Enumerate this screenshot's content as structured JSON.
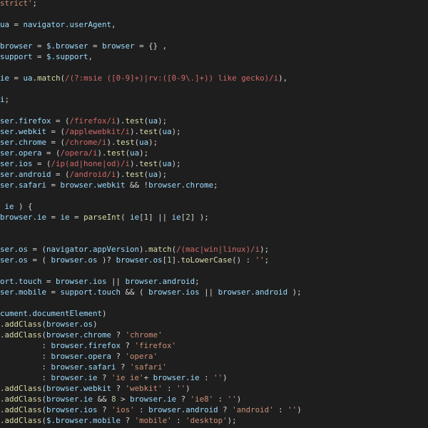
{
  "editor": {
    "theme": {
      "background": "#1e1e1e",
      "identifier": "#9cdcfe",
      "punctuation": "#d4d4d4",
      "string": "#ce9178",
      "regex": "#d16969",
      "function": "#dcdcaa",
      "number": "#b5cea8"
    },
    "lines": [
      [
        [
          "str",
          "strict'"
        ],
        [
          "punc",
          ";"
        ]
      ],
      [],
      [
        [
          "text",
          "ua"
        ],
        [
          "punc",
          " = "
        ],
        [
          "text",
          "navigator.userAgent"
        ],
        [
          "punc",
          ","
        ]
      ],
      [],
      [
        [
          "text",
          "browser"
        ],
        [
          "punc",
          " = "
        ],
        [
          "text",
          "$.browser"
        ],
        [
          "punc",
          " = "
        ],
        [
          "text",
          "browser"
        ],
        [
          "punc",
          " = {} ,"
        ]
      ],
      [
        [
          "text",
          "support"
        ],
        [
          "punc",
          " = "
        ],
        [
          "text",
          "$.support"
        ],
        [
          "punc",
          ","
        ]
      ],
      [],
      [
        [
          "text",
          "ie"
        ],
        [
          "punc",
          " = "
        ],
        [
          "text",
          "ua"
        ],
        [
          "punc",
          "."
        ],
        [
          "func",
          "match"
        ],
        [
          "punc",
          "("
        ],
        [
          "regex",
          "/(?:msie ([0-9]+)|rv:([0-9\\.]+)) like gecko)/i"
        ],
        [
          "punc",
          "),"
        ]
      ],
      [],
      [
        [
          "text",
          "i"
        ],
        [
          "punc",
          ";"
        ]
      ],
      [],
      [
        [
          "text",
          "ser.firefox"
        ],
        [
          "punc",
          " = ("
        ],
        [
          "regex",
          "/firefox/i"
        ],
        [
          "punc",
          ")."
        ],
        [
          "func",
          "test"
        ],
        [
          "punc",
          "("
        ],
        [
          "text",
          "ua"
        ],
        [
          "punc",
          ");"
        ]
      ],
      [
        [
          "text",
          "ser.webkit"
        ],
        [
          "punc",
          " = ("
        ],
        [
          "regex",
          "/applewebkit/i"
        ],
        [
          "punc",
          ")."
        ],
        [
          "func",
          "test"
        ],
        [
          "punc",
          "("
        ],
        [
          "text",
          "ua"
        ],
        [
          "punc",
          ");"
        ]
      ],
      [
        [
          "text",
          "ser.chrome"
        ],
        [
          "punc",
          " = ("
        ],
        [
          "regex",
          "/chrome/i"
        ],
        [
          "punc",
          ")."
        ],
        [
          "func",
          "test"
        ],
        [
          "punc",
          "("
        ],
        [
          "text",
          "ua"
        ],
        [
          "punc",
          ");"
        ]
      ],
      [
        [
          "text",
          "ser.opera"
        ],
        [
          "punc",
          " = ("
        ],
        [
          "regex",
          "/opera/i"
        ],
        [
          "punc",
          ")."
        ],
        [
          "func",
          "test"
        ],
        [
          "punc",
          "("
        ],
        [
          "text",
          "ua"
        ],
        [
          "punc",
          ");"
        ]
      ],
      [
        [
          "text",
          "ser.ios"
        ],
        [
          "punc",
          " = ("
        ],
        [
          "regex",
          "/ip(ad|hone|od)/i"
        ],
        [
          "punc",
          ")."
        ],
        [
          "func",
          "test"
        ],
        [
          "punc",
          "("
        ],
        [
          "text",
          "ua"
        ],
        [
          "punc",
          ");"
        ]
      ],
      [
        [
          "text",
          "ser.android"
        ],
        [
          "punc",
          " = ("
        ],
        [
          "regex",
          "/android/i"
        ],
        [
          "punc",
          ")."
        ],
        [
          "func",
          "test"
        ],
        [
          "punc",
          "("
        ],
        [
          "text",
          "ua"
        ],
        [
          "punc",
          ");"
        ]
      ],
      [
        [
          "text",
          "ser.safari"
        ],
        [
          "punc",
          " = "
        ],
        [
          "text",
          "browser.webkit"
        ],
        [
          "punc",
          " && !"
        ],
        [
          "text",
          "browser.chrome"
        ],
        [
          "punc",
          ";"
        ]
      ],
      [],
      [
        [
          "punc",
          " "
        ],
        [
          "text",
          "ie"
        ],
        [
          "punc",
          " ) {"
        ]
      ],
      [
        [
          "text",
          "browser.ie"
        ],
        [
          "punc",
          " = "
        ],
        [
          "text",
          "ie"
        ],
        [
          "punc",
          " = "
        ],
        [
          "func",
          "parseInt"
        ],
        [
          "punc",
          "( "
        ],
        [
          "text",
          "ie"
        ],
        [
          "punc",
          "["
        ],
        [
          "num",
          "1"
        ],
        [
          "punc",
          "] || "
        ],
        [
          "text",
          "ie"
        ],
        [
          "punc",
          "["
        ],
        [
          "num",
          "2"
        ],
        [
          "punc",
          "] );"
        ]
      ],
      [],
      [],
      [
        [
          "text",
          "ser.os"
        ],
        [
          "punc",
          " = ("
        ],
        [
          "text",
          "navigator.appVersion"
        ],
        [
          "punc",
          ")."
        ],
        [
          "func",
          "match"
        ],
        [
          "punc",
          "("
        ],
        [
          "regex",
          "/(mac|win|linux)/i"
        ],
        [
          "punc",
          ");"
        ]
      ],
      [
        [
          "text",
          "ser.os"
        ],
        [
          "punc",
          " = ( "
        ],
        [
          "text",
          "browser.os"
        ],
        [
          "punc",
          " )? "
        ],
        [
          "text",
          "browser.os"
        ],
        [
          "punc",
          "["
        ],
        [
          "num",
          "1"
        ],
        [
          "punc",
          "]."
        ],
        [
          "func",
          "toLowerCase"
        ],
        [
          "punc",
          "() : "
        ],
        [
          "str",
          "''"
        ],
        [
          "punc",
          ";"
        ]
      ],
      [],
      [
        [
          "text",
          "ort.touch"
        ],
        [
          "punc",
          " = "
        ],
        [
          "text",
          "browser.ios"
        ],
        [
          "punc",
          " || "
        ],
        [
          "text",
          "browser.android"
        ],
        [
          "punc",
          ";"
        ]
      ],
      [
        [
          "text",
          "ser.mobile"
        ],
        [
          "punc",
          " = "
        ],
        [
          "text",
          "support.touch"
        ],
        [
          "punc",
          " && ( "
        ],
        [
          "text",
          "browser.ios"
        ],
        [
          "punc",
          " || "
        ],
        [
          "text",
          "browser.android"
        ],
        [
          "punc",
          " );"
        ]
      ],
      [],
      [
        [
          "text",
          "cument.documentElement"
        ],
        [
          "punc",
          ")"
        ]
      ],
      [
        [
          "punc",
          "."
        ],
        [
          "func",
          "addClass"
        ],
        [
          "punc",
          "("
        ],
        [
          "text",
          "browser.os"
        ],
        [
          "punc",
          ")"
        ]
      ],
      [
        [
          "punc",
          "."
        ],
        [
          "func",
          "addClass"
        ],
        [
          "punc",
          "("
        ],
        [
          "text",
          "browser.chrome"
        ],
        [
          "punc",
          " ? "
        ],
        [
          "str",
          "'chrome'"
        ]
      ],
      [
        [
          "punc",
          "         : "
        ],
        [
          "text",
          "browser.firefox"
        ],
        [
          "punc",
          " ? "
        ],
        [
          "str",
          "'firefox'"
        ]
      ],
      [
        [
          "punc",
          "         : "
        ],
        [
          "text",
          "browser.opera"
        ],
        [
          "punc",
          " ? "
        ],
        [
          "str",
          "'opera'"
        ]
      ],
      [
        [
          "punc",
          "         : "
        ],
        [
          "text",
          "browser.safari"
        ],
        [
          "punc",
          " ? "
        ],
        [
          "str",
          "'safari'"
        ]
      ],
      [
        [
          "punc",
          "         : "
        ],
        [
          "text",
          "browser.ie"
        ],
        [
          "punc",
          " ? "
        ],
        [
          "str",
          "'ie ie'"
        ],
        [
          "punc",
          "+ "
        ],
        [
          "text",
          "browser.ie"
        ],
        [
          "punc",
          " : "
        ],
        [
          "str",
          "''"
        ],
        [
          "punc",
          ")"
        ]
      ],
      [
        [
          "punc",
          "."
        ],
        [
          "func",
          "addClass"
        ],
        [
          "punc",
          "("
        ],
        [
          "text",
          "browser.webkit"
        ],
        [
          "punc",
          " ? "
        ],
        [
          "str",
          "'webkit'"
        ],
        [
          "punc",
          " : "
        ],
        [
          "str",
          "''"
        ],
        [
          "punc",
          ")"
        ]
      ],
      [
        [
          "punc",
          "."
        ],
        [
          "func",
          "addClass"
        ],
        [
          "punc",
          "("
        ],
        [
          "text",
          "browser.ie"
        ],
        [
          "punc",
          " && "
        ],
        [
          "num",
          "8"
        ],
        [
          "punc",
          " > "
        ],
        [
          "text",
          "browser.ie"
        ],
        [
          "punc",
          " ? "
        ],
        [
          "str",
          "'ie8'"
        ],
        [
          "punc",
          " : "
        ],
        [
          "str",
          "''"
        ],
        [
          "punc",
          ")"
        ]
      ],
      [
        [
          "punc",
          "."
        ],
        [
          "func",
          "addClass"
        ],
        [
          "punc",
          "("
        ],
        [
          "text",
          "browser.ios"
        ],
        [
          "punc",
          " ? "
        ],
        [
          "str",
          "'ios'"
        ],
        [
          "punc",
          " : "
        ],
        [
          "text",
          "browser.android"
        ],
        [
          "punc",
          " ? "
        ],
        [
          "str",
          "'android'"
        ],
        [
          "punc",
          " : "
        ],
        [
          "str",
          "''"
        ],
        [
          "punc",
          ")"
        ]
      ],
      [
        [
          "punc",
          "."
        ],
        [
          "func",
          "addClass"
        ],
        [
          "punc",
          "("
        ],
        [
          "text",
          "$.browser.mobile"
        ],
        [
          "punc",
          " ? "
        ],
        [
          "str",
          "'mobile'"
        ],
        [
          "punc",
          " : "
        ],
        [
          "str",
          "'desktop'"
        ],
        [
          "punc",
          ");"
        ]
      ]
    ]
  }
}
